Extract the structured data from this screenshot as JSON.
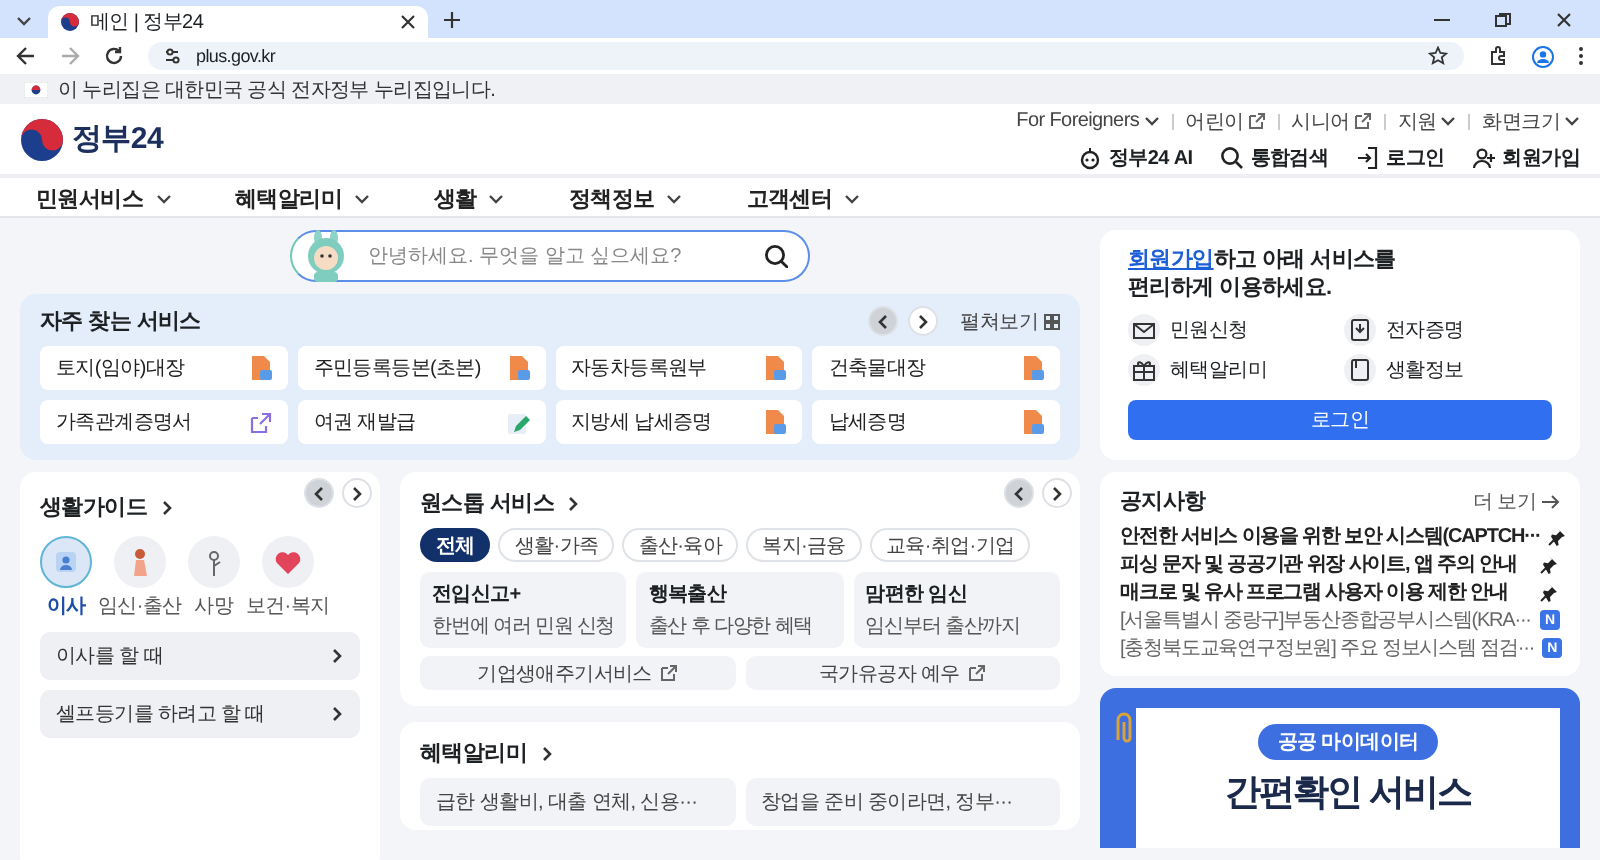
{
  "browser": {
    "tab_title": "메인 | 정부24",
    "url": "plus.gov.kr"
  },
  "gov_notice": "이 누리집은 대한민국 공식 전자정부 누리집입니다.",
  "header": {
    "logo_text": "정부24",
    "util_links": [
      {
        "label": "For Foreigners",
        "kind": "dropdown"
      },
      {
        "label": "어린이",
        "kind": "external"
      },
      {
        "label": "시니어",
        "kind": "external"
      },
      {
        "label": "지원",
        "kind": "dropdown"
      },
      {
        "label": "화면크기",
        "kind": "dropdown"
      }
    ],
    "actions": [
      {
        "label": "정부24 AI",
        "kind": "ai"
      },
      {
        "label": "통합검색",
        "kind": "search"
      },
      {
        "label": "로그인",
        "kind": "login"
      },
      {
        "label": "회원가입",
        "kind": "signup"
      }
    ]
  },
  "nav": [
    "민원서비스",
    "혜택알리미",
    "생활",
    "정책정보",
    "고객센터"
  ],
  "search": {
    "placeholder": "안녕하세요. 무엇을 알고 싶으세요?"
  },
  "frequent": {
    "title": "자주 찾는 서비스",
    "expand": "펼쳐보기",
    "items": [
      {
        "label": "토지(임야)대장",
        "kind": "document"
      },
      {
        "label": "주민등록등본(초본)",
        "kind": "document"
      },
      {
        "label": "자동차등록원부",
        "kind": "document"
      },
      {
        "label": "건축물대장",
        "kind": "document"
      },
      {
        "label": "가족관계증명서",
        "kind": "external"
      },
      {
        "label": "여권 재발급",
        "kind": "edit"
      },
      {
        "label": "지방세 납세증명",
        "kind": "document"
      },
      {
        "label": "납세증명",
        "kind": "document"
      }
    ]
  },
  "life_guide": {
    "title": "생활가이드",
    "categories": [
      {
        "label": "이사",
        "kind": "moving",
        "selected": true
      },
      {
        "label": "임신·출산",
        "kind": "pregnancy",
        "selected": false
      },
      {
        "label": "사망",
        "kind": "death",
        "selected": false
      },
      {
        "label": "보건·복지",
        "kind": "welfare",
        "selected": false
      }
    ],
    "items": [
      "이사를 할 때",
      "셀프등기를 하려고 할 때"
    ]
  },
  "onestop": {
    "title": "원스톱 서비스",
    "filters": [
      {
        "label": "전체",
        "selected": true
      },
      {
        "label": "생활·가족",
        "selected": false
      },
      {
        "label": "출산·육아",
        "selected": false
      },
      {
        "label": "복지·금융",
        "selected": false
      },
      {
        "label": "교육·취업·기업",
        "selected": false
      }
    ],
    "cards": [
      {
        "title": "전입신고+",
        "desc": "한번에 여러 민원 신청"
      },
      {
        "title": "행복출산",
        "desc": "출산 후 다양한 혜택"
      },
      {
        "title": "맘편한 임신",
        "desc": "임신부터 출산까지"
      }
    ],
    "links": [
      "기업생애주기서비스",
      "국가유공자 예우"
    ]
  },
  "benefit": {
    "title": "혜택알리미",
    "cards": [
      "급한 생활비, 대출 연체, 신용···",
      "창업을 준비 중이라면, 정부···"
    ]
  },
  "login_card": {
    "signup_link": "회원가입",
    "text": "하고 아래 서비스를 편리하게 이용하세요.",
    "services": [
      {
        "label": "민원신청",
        "kind": "mail"
      },
      {
        "label": "전자증명",
        "kind": "certificate"
      },
      {
        "label": "혜택알리미",
        "kind": "gift"
      },
      {
        "label": "생활정보",
        "kind": "note"
      }
    ],
    "button": "로그인"
  },
  "notices": {
    "title": "공지사항",
    "more": "더 보기",
    "items": [
      {
        "text": "안전한 서비스 이용을 위한 보안 시스템(CAPTCH···",
        "pinned": true
      },
      {
        "text": "피싱 문자 및 공공기관 위장 사이트, 앱 주의 안내",
        "pinned": true
      },
      {
        "text": "매크로 및 유사 프로그램 사용자 이용 제한 안내",
        "pinned": true
      },
      {
        "text": "[서울특별시 중랑구]부동산종합공부시스템(KRA···",
        "pinned": false,
        "badge": "N"
      },
      {
        "text": "[충청북도교육연구정보원] 주요 정보시스템 점검···",
        "pinned": false,
        "badge": "N"
      }
    ]
  },
  "promo": {
    "tag": "공공 마이데이터",
    "headline": "간편확인 서비스"
  }
}
